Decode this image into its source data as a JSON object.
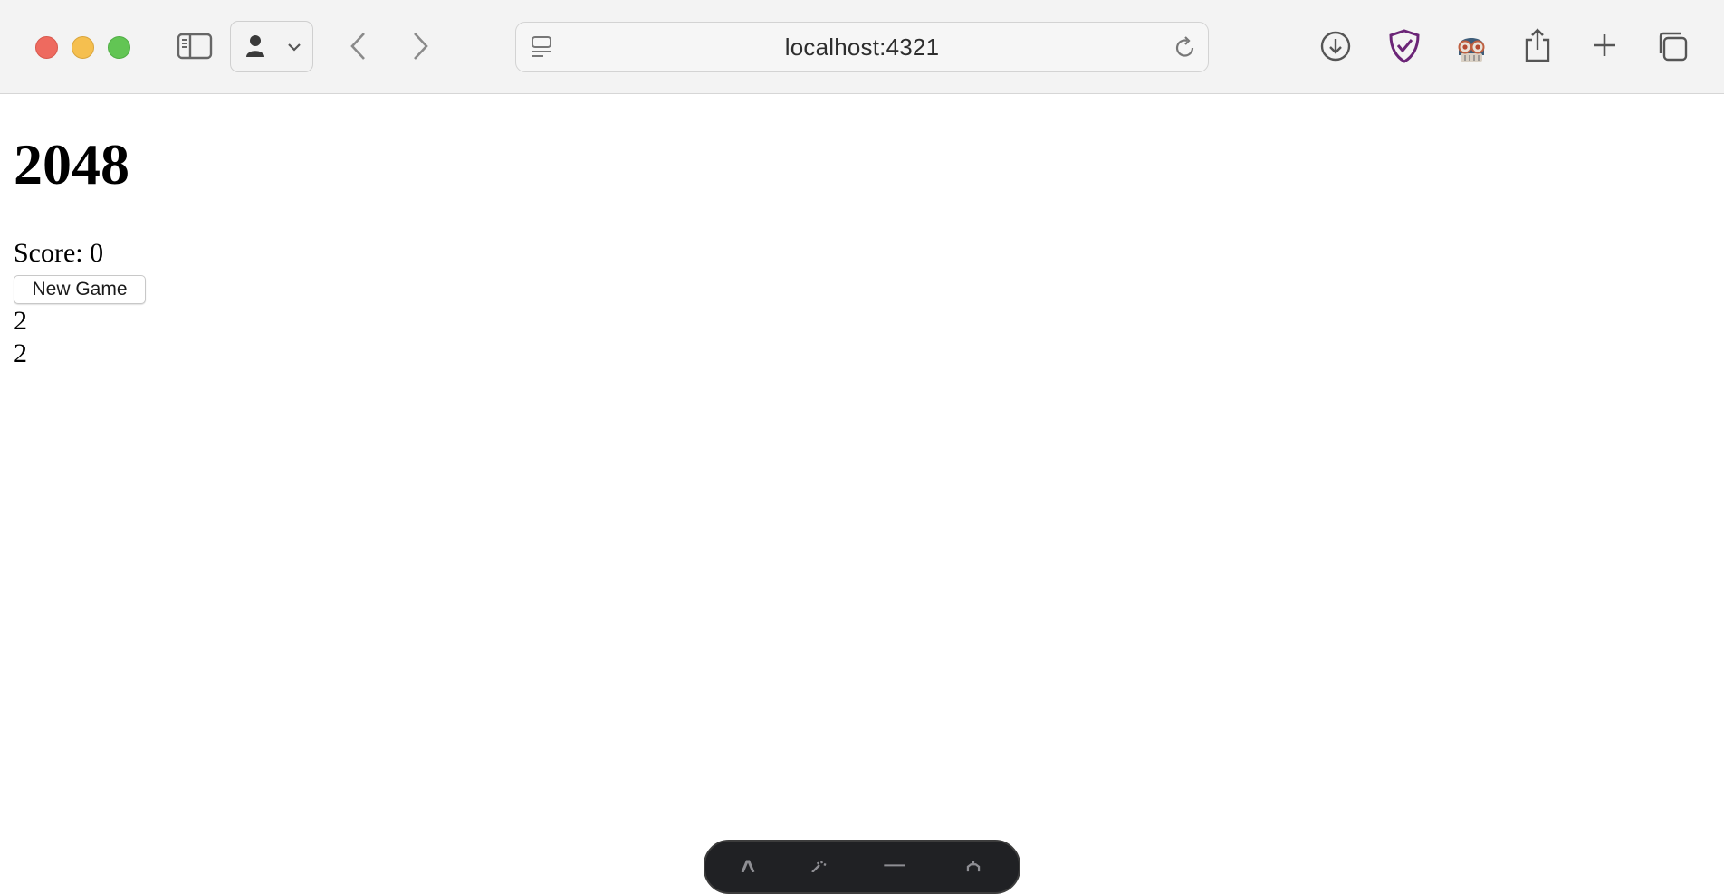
{
  "browser": {
    "url": "localhost:4321",
    "icons": {
      "sidebar": "sidebar-toggle-icon",
      "profile": "person-icon",
      "profile_dropdown": "chevron-down-icon",
      "back": "chevron-left-icon",
      "forward": "chevron-right-icon",
      "reader": "reader-mode-icon",
      "reload": "reload-icon",
      "downloads": "download-icon",
      "extension_shield": "shield-check-icon",
      "extension_avatar": "goggles-avatar-icon",
      "share": "share-icon",
      "new_tab": "plus-icon",
      "tab_overview": "tabs-overview-icon"
    },
    "colors": {
      "close": "#ee6a5f",
      "minimize": "#f5bf4f",
      "zoom": "#62c554",
      "shield": "#6b2577"
    }
  },
  "page": {
    "title": "2048",
    "score_text": "Score: 0",
    "new_game_label": "New Game",
    "tiles": [
      "2",
      "2"
    ]
  },
  "dev_toolbar": {
    "icons": [
      "astro-icon",
      "sparkle-icon",
      "menu-icon",
      "gear-icon"
    ],
    "background": "#202124"
  }
}
